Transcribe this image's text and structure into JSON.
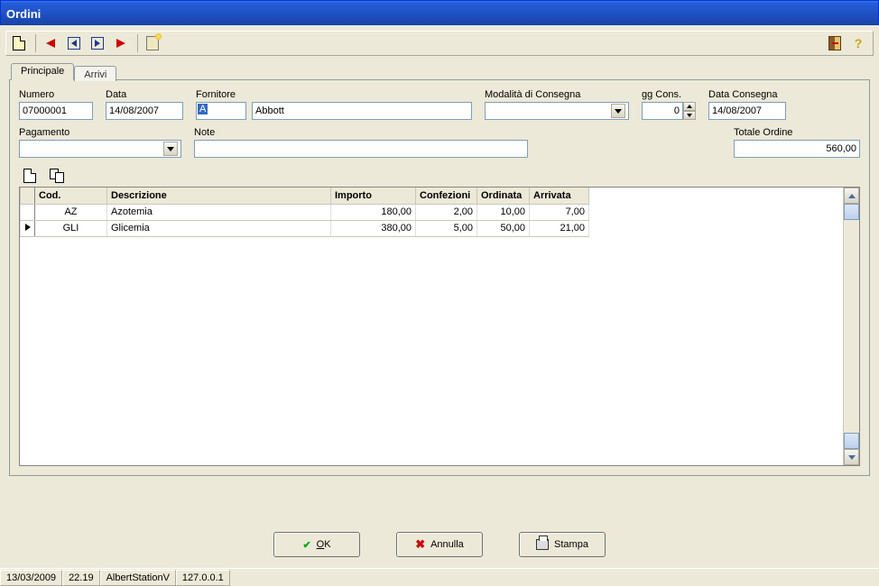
{
  "title": "Ordini",
  "tabs": {
    "principale": "Principale",
    "arrivi": "Arrivi"
  },
  "labels": {
    "numero": "Numero",
    "data": "Data",
    "fornitore": "Fornitore",
    "modalita": "Modalità di Consegna",
    "ggcons": "gg Cons.",
    "dataconsegna": "Data Consegna",
    "pagamento": "Pagamento",
    "note": "Note",
    "totale": "Totale Ordine"
  },
  "fields": {
    "numero": "07000001",
    "data": "14/08/2007",
    "fornitore_code": "A",
    "fornitore_name": "Abbott",
    "modalita": "",
    "ggcons": "0",
    "dataconsegna": "14/08/2007",
    "pagamento": "",
    "note": "",
    "totale": "560,00"
  },
  "grid": {
    "headers": {
      "cod": "Cod.",
      "descr": "Descrizione",
      "importo": "Importo",
      "confezioni": "Confezioni",
      "ordinata": "Ordinata",
      "arrivata": "Arrivata"
    },
    "rows": [
      {
        "cod": "AZ",
        "descr": "Azotemia",
        "importo": "180,00",
        "confezioni": "2,00",
        "ordinata": "10,00",
        "arrivata": "7,00",
        "current": false
      },
      {
        "cod": "GLI",
        "descr": "Glicemia",
        "importo": "380,00",
        "confezioni": "5,00",
        "ordinata": "50,00",
        "arrivata": "21,00",
        "current": true
      }
    ]
  },
  "buttons": {
    "ok": "OK",
    "annulla": "Annulla",
    "stampa": "Stampa"
  },
  "status": {
    "date": "13/03/2009",
    "time": "22.19",
    "station": "AlbertStationV",
    "ip": "127.0.0.1"
  }
}
